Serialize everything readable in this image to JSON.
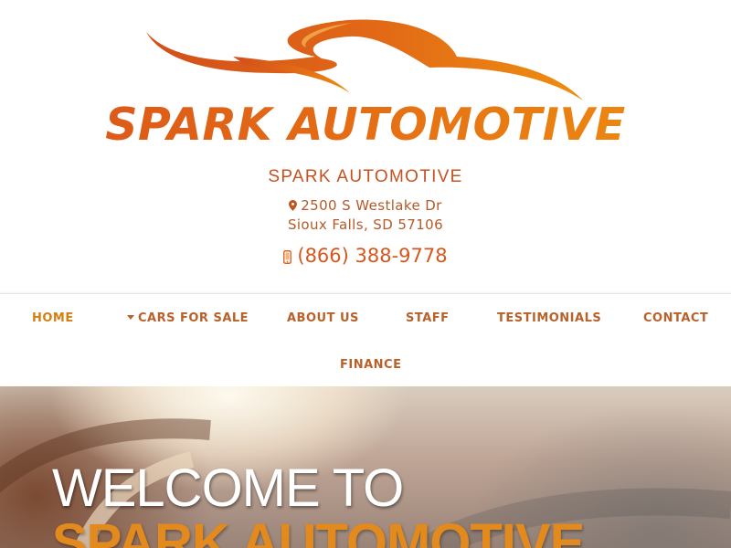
{
  "brand": {
    "logo_text": "SPARK AUTOMOTIVE",
    "name": "SPARK AUTOMOTIVE",
    "colors": {
      "primary": "#d6571c",
      "accent": "#ef8f0f",
      "nav_text": "#b8612a",
      "nav_active": "#d57f12"
    }
  },
  "contact": {
    "address_line1": "2500 S Westlake Dr",
    "address_line2": "Sioux Falls, SD 57106",
    "phone": "(866) 388-9778",
    "address_icon": "map-pin-icon",
    "phone_icon": "mobile-phone-icon"
  },
  "nav": {
    "items": [
      {
        "label": "HOME",
        "active": true
      },
      {
        "label": "CARS FOR SALE",
        "has_dropdown": true
      },
      {
        "label": "ABOUT US"
      },
      {
        "label": "STAFF"
      },
      {
        "label": "TESTIMONIALS"
      },
      {
        "label": "CONTACT"
      },
      {
        "label": "FINANCE"
      }
    ]
  },
  "hero": {
    "line1": "WELCOME TO",
    "line2": "SPARK AUTOMOTIVE"
  }
}
